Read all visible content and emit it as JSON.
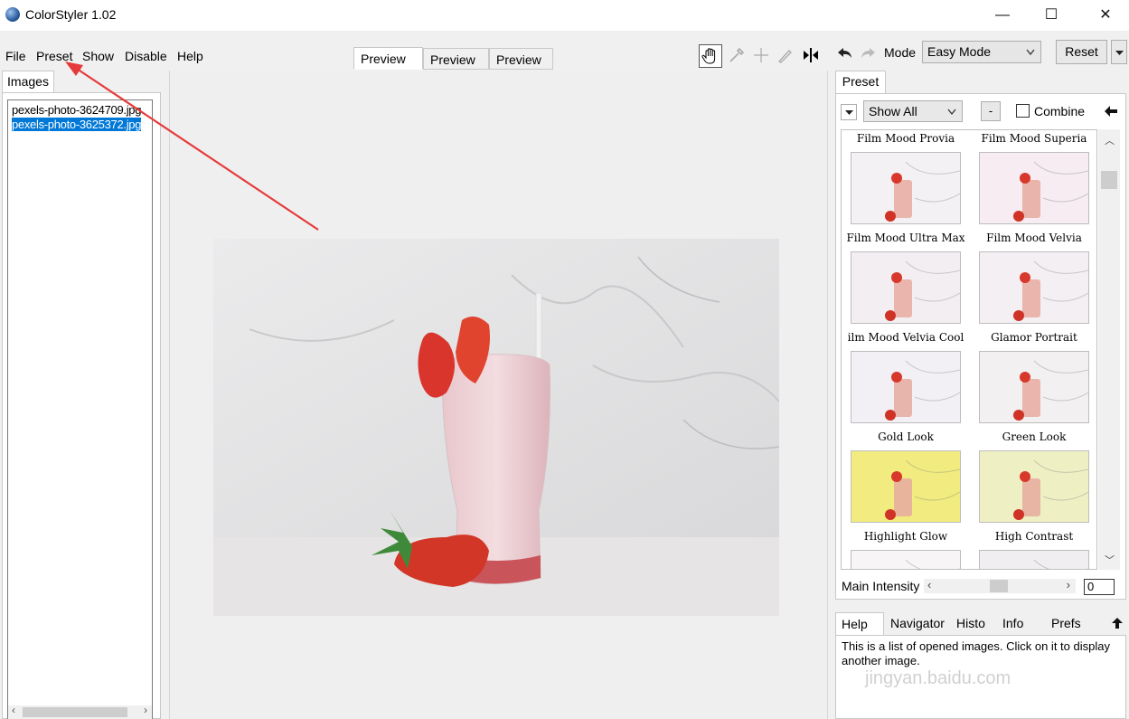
{
  "window": {
    "title": "ColorStyler 1.02",
    "min_glyph": "—",
    "max_glyph": "☐",
    "close_glyph": "✕"
  },
  "menu": [
    "File",
    "Preset",
    "Show",
    "Disable",
    "Help"
  ],
  "preview_tabs": [
    "Preview 1",
    "Preview 2",
    "Preview 3"
  ],
  "toolbar": {
    "mode_label": "Mode",
    "mode_value": "Easy Mode",
    "reset_label": "Reset"
  },
  "images_panel": {
    "tab": "Images",
    "files": [
      "pexels-photo-3624709.jpg",
      "pexels-photo-3625372.jpg"
    ],
    "selected_index": 1
  },
  "preset_panel": {
    "tab": "Preset",
    "filter_value": "Show All",
    "minus_label": "-",
    "combine_label": "Combine",
    "presets": [
      {
        "name": "Film Mood Provia",
        "tint": "#f4f1f4"
      },
      {
        "name": "Film Mood Superia",
        "tint": "#f6ecf1"
      },
      {
        "name": "Film Mood Ultra Max",
        "tint": "#f3eef2"
      },
      {
        "name": "Film Mood Velvia",
        "tint": "#f4eff3"
      },
      {
        "name": "ilm Mood Velvia Cool",
        "tint": "#f2f0f5"
      },
      {
        "name": "Glamor Portrait",
        "tint": "#f3f0f2"
      },
      {
        "name": "Gold Look",
        "tint": "#f2ec80"
      },
      {
        "name": "Green Look",
        "tint": "#eef0c4"
      },
      {
        "name": "Highlight Glow",
        "tint": "#f7f5f5"
      },
      {
        "name": "High Contrast",
        "tint": "#f0eef0"
      }
    ],
    "intensity_label": "Main Intensity",
    "intensity_value": "0"
  },
  "bottom_tabs": [
    "Help",
    "Navigator",
    "Histo",
    "Info",
    "Prefs"
  ],
  "help_text": "This is a list of opened images. Click on it to display another image.",
  "watermark": "jingyan.baidu.com"
}
